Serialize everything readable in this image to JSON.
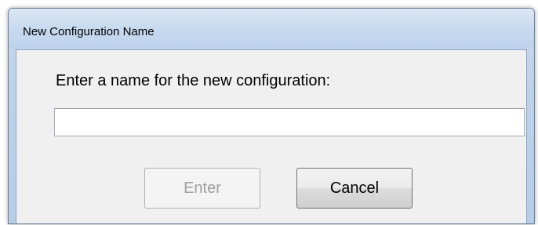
{
  "window": {
    "title": "New Configuration Name"
  },
  "dialog": {
    "prompt": "Enter a name for the new configuration:",
    "name_input": {
      "value": "",
      "placeholder": ""
    },
    "enter_button": {
      "label": "Enter",
      "enabled": false
    },
    "cancel_button": {
      "label": "Cancel",
      "enabled": true
    }
  },
  "colors": {
    "titlebar": "#c8daf0",
    "client_background": "#f0f0f0",
    "disabled_text": "#a0a0a0"
  }
}
